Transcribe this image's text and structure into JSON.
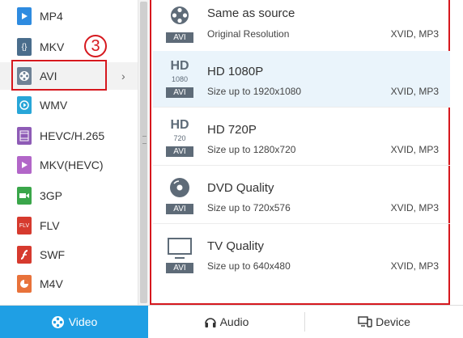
{
  "formats": [
    {
      "label": "MP4",
      "icon": "mp4-icon",
      "color": "#2e8be0"
    },
    {
      "label": "MKV",
      "icon": "mkv-icon",
      "color": "#4a6d8c"
    },
    {
      "label": "AVI",
      "icon": "avi-icon",
      "color": "#6f8296",
      "active": true
    },
    {
      "label": "WMV",
      "icon": "wmv-icon",
      "color": "#28a6d8"
    },
    {
      "label": "HEVC/H.265",
      "icon": "hevc-icon",
      "color": "#8e5bb6"
    },
    {
      "label": "MKV(HEVC)",
      "icon": "mkv-hevc-icon",
      "color": "#b266c8"
    },
    {
      "label": "3GP",
      "icon": "3gp-icon",
      "color": "#3aa64a"
    },
    {
      "label": "FLV",
      "icon": "flv-icon",
      "color": "#d63a2e"
    },
    {
      "label": "SWF",
      "icon": "swf-icon",
      "color": "#d63a2e"
    },
    {
      "label": "M4V",
      "icon": "m4v-icon",
      "color": "#e8723a"
    }
  ],
  "chevron": "›",
  "annotation": {
    "number": "3"
  },
  "presets": [
    {
      "name": "Same as source",
      "desc": "Original Resolution",
      "codec": "XVID, MP3",
      "icon": "film-reel-icon",
      "tag": "AVI"
    },
    {
      "name": "HD 1080P",
      "desc": "Size up to 1920x1080",
      "codec": "XVID, MP3",
      "icon": "hd-1080-icon",
      "tag": "AVI",
      "badge": "HD",
      "sub": "1080",
      "selected": true
    },
    {
      "name": "HD 720P",
      "desc": "Size up to 1280x720",
      "codec": "XVID, MP3",
      "icon": "hd-720-icon",
      "tag": "AVI",
      "badge": "HD",
      "sub": "720"
    },
    {
      "name": "DVD Quality",
      "desc": "Size up to 720x576",
      "codec": "XVID, MP3",
      "icon": "dvd-icon",
      "tag": "AVI"
    },
    {
      "name": "TV Quality",
      "desc": "Size up to 640x480",
      "codec": "XVID, MP3",
      "icon": "tv-icon",
      "tag": "AVI"
    }
  ],
  "tabs": [
    {
      "label": "Video",
      "icon": "film-reel-icon",
      "active": true
    },
    {
      "label": "Audio",
      "icon": "headphones-icon"
    },
    {
      "label": "Device",
      "icon": "device-icon"
    }
  ]
}
